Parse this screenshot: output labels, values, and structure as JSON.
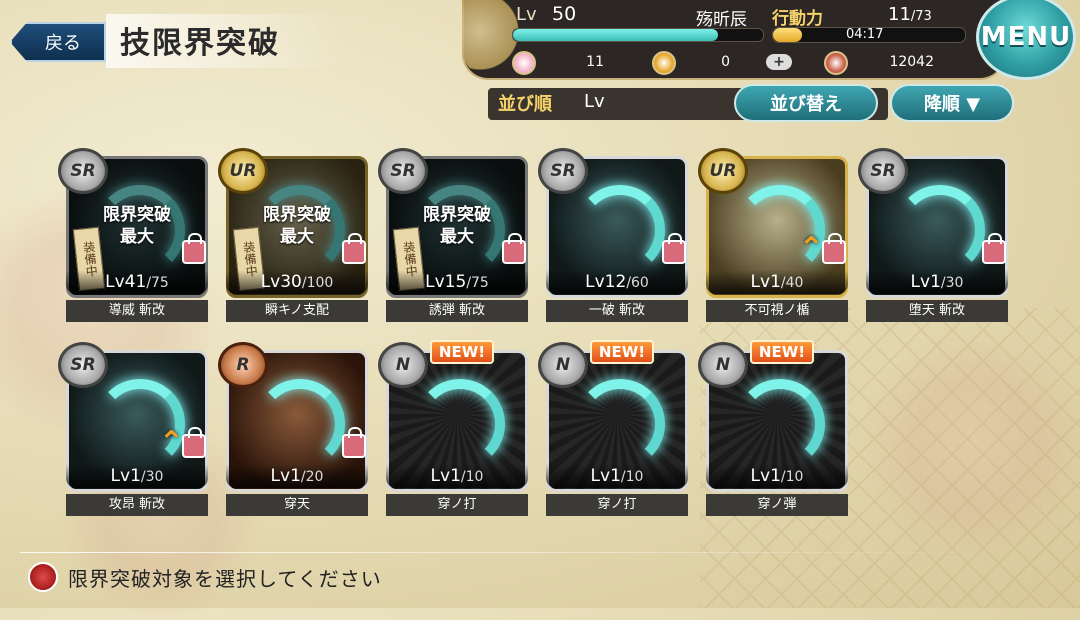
{
  "header": {
    "back_label": "戻る",
    "title": "技限界突破"
  },
  "status": {
    "lv_label": "Lv",
    "lv_value": "50",
    "player_name": "殇昕辰",
    "exp_fraction": 0.82,
    "ap_label": "行動力",
    "ap_current": "11",
    "ap_max": "/73",
    "ap_fraction": 0.15,
    "ap_timer": "04:17",
    "currency": [
      {
        "icon": "gem-icon",
        "value": "11",
        "color": "#f2b6c8"
      },
      {
        "icon": "coin-icon",
        "value": "0",
        "color": "#e8a830"
      },
      {
        "icon": "token-icon",
        "value": "12042",
        "color": "#c8604a"
      }
    ],
    "plus_label": "+",
    "menu_label": "MENU"
  },
  "sort": {
    "label": "並び順",
    "value": "Lv",
    "sort_button": "並び替え",
    "order_button": "降順 ▼"
  },
  "cards": [
    {
      "rarity": "SR",
      "lv": "Lv41",
      "max": "/75",
      "name": "導威 斬改",
      "overlay": "限界突破\n最大",
      "equipped": "装備中",
      "locked": true
    },
    {
      "rarity": "UR",
      "lv": "Lv30",
      "max": "/100",
      "name": "瞬キノ支配",
      "overlay": "限界突破\n最大",
      "equipped": "装備中",
      "locked": true
    },
    {
      "rarity": "SR",
      "lv": "Lv15",
      "max": "/75",
      "name": "誘弾 斬改",
      "overlay": "限界突破\n最大",
      "equipped": "装備中",
      "locked": true
    },
    {
      "rarity": "SR",
      "lv": "Lv12",
      "max": "/60",
      "name": "一破 斬改",
      "locked": true
    },
    {
      "rarity": "UR",
      "lv": "Lv1",
      "max": "/40",
      "name": "不可視ノ楯",
      "locked": true,
      "up": true
    },
    {
      "rarity": "SR",
      "lv": "Lv1",
      "max": "/30",
      "name": "堕天 斬改",
      "locked": true
    },
    {
      "rarity": "SR",
      "lv": "Lv1",
      "max": "/30",
      "name": "攻昂 斬改",
      "locked": true,
      "up": true
    },
    {
      "rarity": "R",
      "lv": "Lv1",
      "max": "/20",
      "name": "穿天",
      "locked": true
    },
    {
      "rarity": "N",
      "lv": "Lv1",
      "max": "/10",
      "name": "穿ノ打",
      "new": "NEW!"
    },
    {
      "rarity": "N",
      "lv": "Lv1",
      "max": "/10",
      "name": "穿ノ打",
      "new": "NEW!"
    },
    {
      "rarity": "N",
      "lv": "Lv1",
      "max": "/10",
      "name": "穿ノ弾",
      "new": "NEW!"
    }
  ],
  "footer": {
    "instruction": "限界突破対象を選択してください"
  }
}
